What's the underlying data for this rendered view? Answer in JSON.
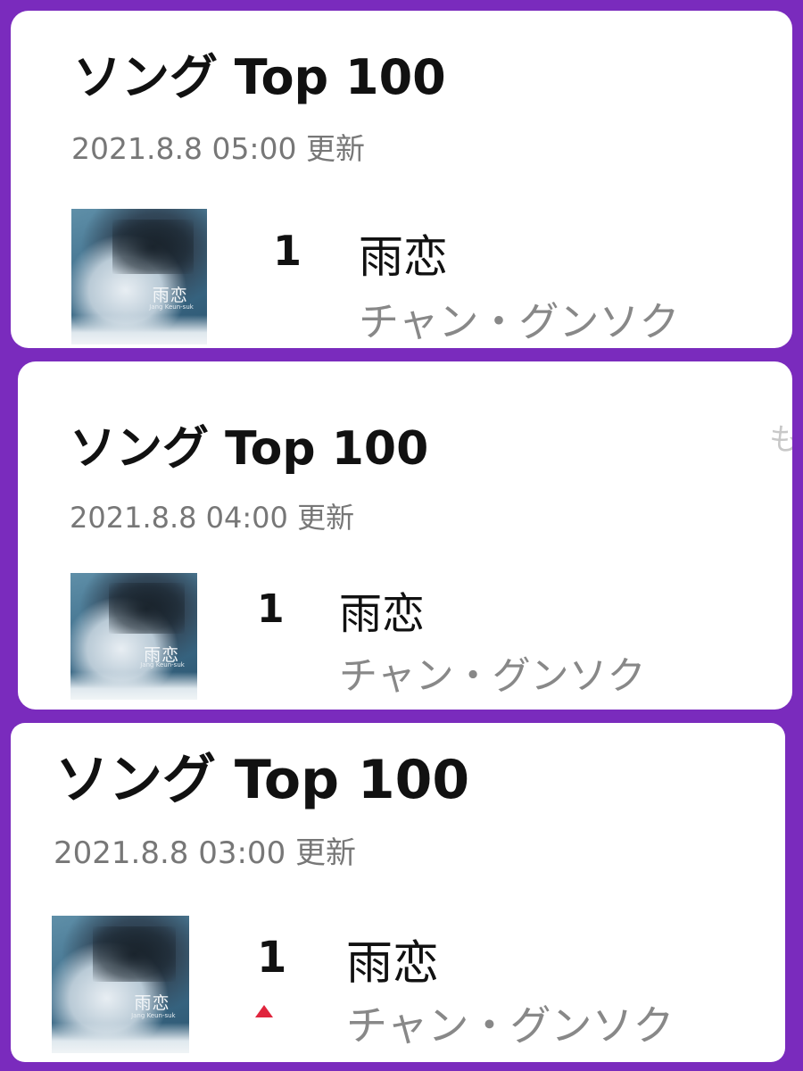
{
  "cards": [
    {
      "title": "ソング Top 100",
      "updated": "2021.8.8 05:00 更新",
      "entry": {
        "rank": "1",
        "song": "雨恋",
        "artist": "チャン・グンソク",
        "cover_title": "雨恋",
        "cover_subtitle": "Jang Keun-suk",
        "trend": null
      }
    },
    {
      "title": "ソング Top 100",
      "updated": "2021.8.8 04:00 更新",
      "clipped_link": "も",
      "entry": {
        "rank": "1",
        "song": "雨恋",
        "artist": "チャン・グンソク",
        "cover_title": "雨恋",
        "cover_subtitle": "Jang Keun-suk",
        "trend": null
      }
    },
    {
      "title": "ソング Top 100",
      "updated": "2021.8.8 03:00 更新",
      "entry": {
        "rank": "1",
        "song": "雨恋",
        "artist": "チャン・グンソク",
        "cover_title": "雨恋",
        "cover_subtitle": "Jang Keun-suk",
        "trend": "up"
      }
    }
  ],
  "colors": {
    "background": "#7a2bbd",
    "card": "#ffffff",
    "trend_up": "#e0253d",
    "secondary_text": "#888888"
  }
}
